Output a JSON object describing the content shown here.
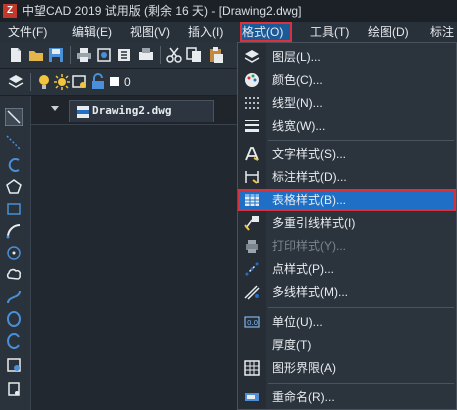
{
  "window": {
    "title": "中望CAD 2019 试用版 (剩余 16 天) - [Drawing2.dwg]",
    "app_icon": "Z"
  },
  "menubar": {
    "items": [
      {
        "label": "文件(F)"
      },
      {
        "label": "编辑(E)"
      },
      {
        "label": "视图(V)"
      },
      {
        "label": "插入(I)"
      },
      {
        "label": "格式(O)"
      },
      {
        "label": "工具(T)"
      },
      {
        "label": "绘图(D)"
      },
      {
        "label": "标注"
      }
    ],
    "active": "格式(O)"
  },
  "layer_toolbar": {
    "current_layer": "0"
  },
  "document": {
    "tab_label": "Drawing2.dwg"
  },
  "format_menu": {
    "items": [
      {
        "label": "图层(L)...",
        "icon": "layers-icon"
      },
      {
        "label": "颜色(C)...",
        "icon": "palette-icon"
      },
      {
        "label": "线型(N)...",
        "icon": "linetype-icon"
      },
      {
        "label": "线宽(W)...",
        "icon": "lineweight-icon"
      },
      {
        "label": "文字样式(S)...",
        "icon": "text-style-icon"
      },
      {
        "label": "标注样式(D)...",
        "icon": "dimension-style-icon"
      },
      {
        "label": "表格样式(B)...",
        "icon": "table-style-icon",
        "highlighted": true
      },
      {
        "label": "多重引线样式(I)",
        "icon": "multileader-style-icon"
      },
      {
        "label": "打印样式(Y)...",
        "icon": "plot-style-icon",
        "disabled": true
      },
      {
        "label": "点样式(P)...",
        "icon": "point-style-icon"
      },
      {
        "label": "多线样式(M)...",
        "icon": "multiline-style-icon"
      },
      {
        "label": "单位(U)...",
        "icon": "units-icon"
      },
      {
        "label": "厚度(T)",
        "icon": ""
      },
      {
        "label": "图形界限(A)",
        "icon": "drawing-limits-icon"
      },
      {
        "label": "重命名(R)...",
        "icon": "rename-icon"
      }
    ]
  },
  "colors": {
    "highlight": "#1e6fc5",
    "focus_border": "#d9323a",
    "menu_bg": "#2b333c",
    "canvas_bg": "#212830"
  }
}
